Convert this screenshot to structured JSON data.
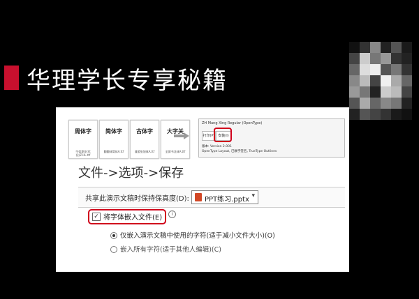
{
  "slide": {
    "title": "华理学长专享秘籍"
  },
  "font_preview": {
    "cards": [
      {
        "glyph": "周体字",
        "caption": "生如夏花(优化)Z.HL.ttf"
      },
      {
        "glyph": "简体字",
        "caption": "翻翻体简体A.ttf"
      },
      {
        "glyph": "古体字",
        "caption": "漫游张旭体A.ttf"
      },
      {
        "glyph": "大字关",
        "caption": "全屏书法体A.ttf"
      }
    ],
    "font_name": "ZH Mang Xing Regular (OpenType)",
    "print_label": "打印(P)",
    "install_label": "安装(I)",
    "version": "版本: Version 2.001",
    "type_line": "OpenType Layout, 已数字签名, TrueType Outlines"
  },
  "options": {
    "heading": "文件->选项->保存",
    "fidelity_label": "共享此演示文稿时保持保真度(D):",
    "presentation_name": "PPT练习.pptx",
    "embed_fonts_label": "将字体嵌入文件(E)",
    "embed_subset_label": "仅嵌入演示文稿中使用的字符(适于减小文件大小)(O)",
    "embed_all_label": "嵌入所有字符(适于其他人编辑)(C)",
    "embed_fonts_checked": true,
    "selected_option": "embed_subset"
  },
  "colors": {
    "accent_red": "#c8102e",
    "highlight_red": "#d0021b",
    "background": "#000000"
  }
}
